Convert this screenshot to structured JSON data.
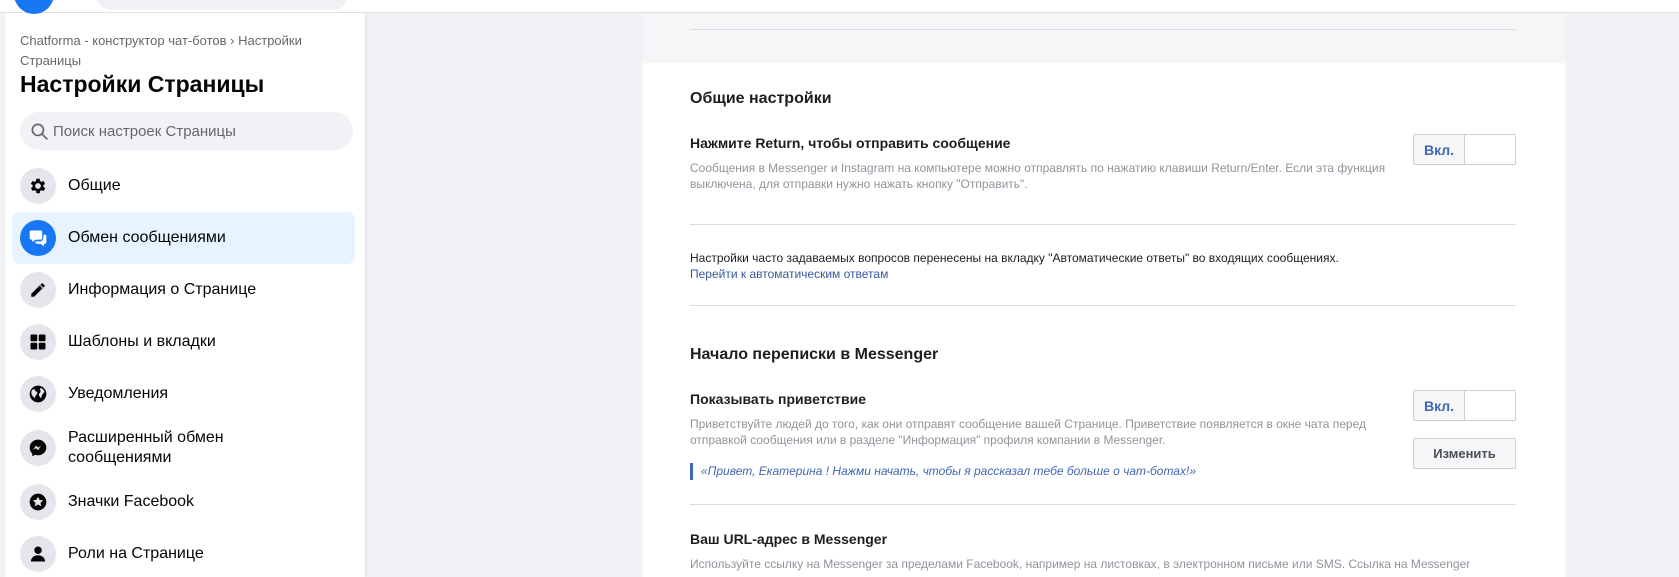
{
  "sidebar": {
    "breadcrumb": "Chatforma - конструктор чат-ботов › Настройки Страницы",
    "title": "Настройки Страницы",
    "search_placeholder": "Поиск настроек Страницы",
    "items": [
      {
        "label": "Общие",
        "icon": "gear-icon"
      },
      {
        "label": "Обмен сообщениями",
        "icon": "messages-icon",
        "active": true
      },
      {
        "label": "Информация о Странице",
        "icon": "pencil-icon"
      },
      {
        "label": "Шаблоны и вкладки",
        "icon": "grid-icon"
      },
      {
        "label": "Уведомления",
        "icon": "globe-icon"
      },
      {
        "label": "Расширенный обмен сообщениями",
        "icon": "messenger-icon"
      },
      {
        "label": "Значки Facebook",
        "icon": "badge-icon"
      },
      {
        "label": "Роли на Странице",
        "icon": "person-icon"
      }
    ]
  },
  "main": {
    "general": {
      "title": "Общие настройки",
      "return_title": "Нажмите Return, чтобы отправить сообщение",
      "return_desc": "Сообщения в Messenger и Instagram на компьютере можно отправлять по нажатию клавиши Return/Enter. Если эта функция выключена, для отправки нужно нажать кнопку \"Отправить\".",
      "return_toggle": "Вкл.",
      "faq_note": "Настройки часто задаваемых вопросов перенесены на вкладку \"Автоматические ответы\" во входящих сообщениях.",
      "faq_link": "Перейти к автоматическим ответам"
    },
    "start": {
      "title": "Начало переписки в Messenger",
      "greeting_title": "Показывать приветствие",
      "greeting_desc": "Приветствуйте людей до того, как они отправят сообщение вашей Странице. Приветствие появляется в окне чата перед отправкой сообщения или в разделе \"Информация\" профиля компании в Messenger.",
      "greeting_toggle": "Вкл.",
      "edit_button": "Изменить",
      "greeting_text": "«Привет, Екатерина ! Нажми начать, чтобы я рассказал тебе больше о чат-ботах!»",
      "url_title": "Ваш URL-адрес в Messenger",
      "url_desc": "Используйте ссылку на Messenger за пределами Facebook, например на листовках, в электронном письме или SMS. Ссылка на Messenger"
    }
  },
  "colors": {
    "accent": "#1877f2",
    "link": "#385898",
    "active_bg": "#e7f3ff"
  }
}
